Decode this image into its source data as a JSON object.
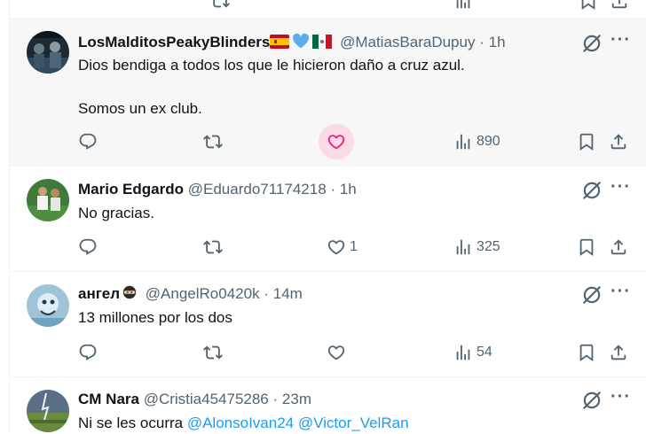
{
  "colors": {
    "accent": "#1d9bf0",
    "muted": "#536471",
    "text": "#0f1419",
    "like_hover": "#f91880",
    "divider": "#eff3f4",
    "hover_bg": "#f7f7f7"
  },
  "icons": {
    "reply": "reply-icon",
    "repost": "repost-icon",
    "like": "heart-icon",
    "views": "views-icon",
    "bookmark": "bookmark-icon",
    "share": "share-icon",
    "grok": "grok-icon",
    "more": "more-icon"
  },
  "replies": [
    {
      "name": "LosMalditosPeakyBlinders",
      "name_emojis": [
        "spain-flag",
        "blue-heart",
        "mexico-flag"
      ],
      "handle": "@MatiasBaraDupuy",
      "separator": "·",
      "time": "1h",
      "text_line1": "Dios bendiga a todos los que le hicieron daño a cruz azul.",
      "text_line2": "Somos un ex club.",
      "likes": "",
      "views": "890",
      "hovered_action": "like"
    },
    {
      "name": "Mario Edgardo",
      "handle": "@Eduardo71174218",
      "separator": "·",
      "time": "1h",
      "text_line1": "No gracias.",
      "likes": "1",
      "views": "325"
    },
    {
      "name": "ангел",
      "name_emojis": [
        "ninja"
      ],
      "handle": "@AngelRo0420k",
      "separator": "·",
      "time": "14m",
      "text_line1": "13 millones por los dos",
      "likes": "",
      "views": "54"
    },
    {
      "name": "CM Nara",
      "handle": "@Cristia45475286",
      "separator": "·",
      "time": "23m",
      "text_prefix": "Ni se les ocurra ",
      "mention1": "@AlonsoIvan24",
      "mention2": "@Victor_VelRan"
    }
  ]
}
